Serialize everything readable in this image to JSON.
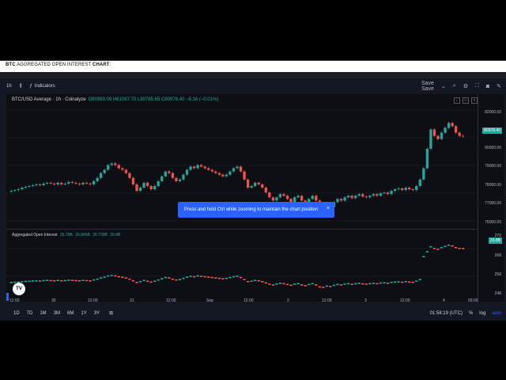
{
  "banner": {
    "bold1": "BTC",
    "text": " AGGREGATED OPEN INTEREST ",
    "bold2": "CHART",
    "colon": ":"
  },
  "toolbar": {
    "interval": "1h",
    "indicators": "Indicators",
    "save_label": "Save",
    "save_sub": "Save"
  },
  "legend": {
    "symbol": "BTC/USD Average · 1h · Coinalyze",
    "ohlc": "O80969.09 H81067.70 L80765.65 C80978.40 −8.16 (−0.01%)"
  },
  "oi_legend": {
    "title": "Aggregated Open Interest",
    "values": [
      "26.78B",
      "26.846B",
      "26.739B",
      "26.8B"
    ]
  },
  "price_axis": {
    "labels": [
      "82000.00",
      "81000.00",
      "80000.00",
      "79000.00",
      "78000.00",
      "77000.00",
      "76000.00"
    ],
    "badge": "80978.40"
  },
  "oi_axis": {
    "labels": [
      "270",
      "268",
      "258",
      "248"
    ],
    "badge": "26.8B"
  },
  "time_axis": [
    "12:00",
    "30",
    "12:00",
    "31",
    "12:00",
    "Sep",
    "12:00",
    "2",
    "12:00",
    "3",
    "12:00",
    "4",
    "09:00"
  ],
  "toast": {
    "text": "Press and hold Ctrl while zooming to maintain the chart position",
    "close": "×"
  },
  "bottom": {
    "ranges": [
      "1D",
      "7D",
      "1M",
      "3M",
      "6M",
      "1Y",
      "3Y"
    ],
    "clock": "01:58:19 (UTC)",
    "percent": "%",
    "log": "log",
    "auto": "auto"
  },
  "logo": "TV",
  "colors": {
    "up": "#26a69a",
    "down": "#ef5350",
    "accent": "#2962ff"
  },
  "chart_data": {
    "type": "candlestick",
    "title": "BTC/USD Average · 1h · Coinalyze",
    "ylim": [
      75500,
      82500
    ],
    "closes": [
      77600,
      77650,
      77700,
      77800,
      77850,
      77900,
      77950,
      78000,
      77950,
      78050,
      78100,
      78050,
      78000,
      78100,
      78000,
      78050,
      78150,
      78100,
      78050,
      78000,
      78100,
      78050,
      78000,
      78200,
      78400,
      78700,
      78900,
      79200,
      79300,
      79200,
      79000,
      78900,
      78700,
      78400,
      78000,
      77600,
      77800,
      78100,
      77900,
      77700,
      77900,
      78200,
      78500,
      78800,
      78700,
      78400,
      78200,
      78300,
      78600,
      78900,
      79100,
      79000,
      79200,
      79100,
      79000,
      78900,
      78800,
      78700,
      78600,
      78500,
      78600,
      78800,
      79000,
      79100,
      78800,
      78300,
      77800,
      77900,
      78100,
      78000,
      77800,
      77500,
      77200,
      77000,
      77200,
      77400,
      77300,
      77100,
      76900,
      77200,
      77300,
      77000,
      76800,
      77100,
      77300,
      77000,
      76500,
      76400,
      76700,
      76600,
      76900,
      77100,
      77000,
      77200,
      77300,
      77150,
      77300,
      77400,
      77250,
      77200,
      77300,
      77400,
      77300,
      77450,
      77500,
      77400,
      77600,
      77700,
      77750,
      77650,
      77800,
      77700,
      77650,
      77900,
      78300,
      79000,
      80200,
      81400,
      81000,
      80800,
      81200,
      81500,
      81800,
      81600,
      81200,
      81000,
      80970
    ],
    "oi_ylim": [
      248,
      271
    ]
  }
}
